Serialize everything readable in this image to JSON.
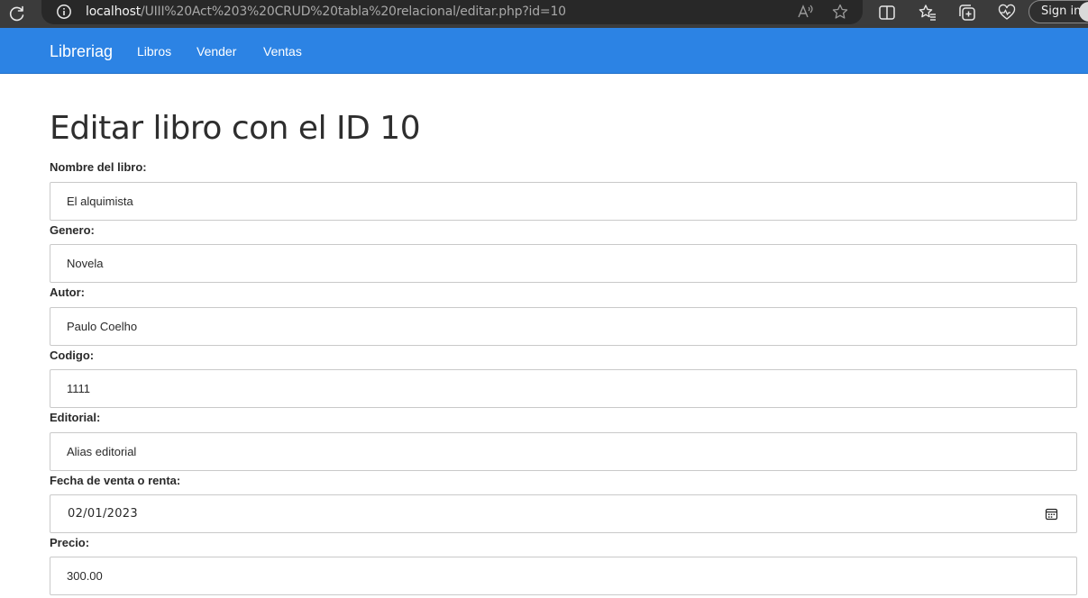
{
  "browser": {
    "url_host": "localhost",
    "url_path": "/UIII%20Act%203%20CRUD%20tabla%20relacional/editar.php?id=10",
    "signin_label": "Sign in"
  },
  "navbar": {
    "brand": "Libreriag",
    "links": [
      "Libros",
      "Vender",
      "Ventas"
    ]
  },
  "page": {
    "title": "Editar libro con el ID 10"
  },
  "form": {
    "fields": [
      {
        "label": "Nombre del libro:",
        "value": "El alquimista"
      },
      {
        "label": "Genero:",
        "value": "Novela"
      },
      {
        "label": "Autor:",
        "value": "Paulo Coelho"
      },
      {
        "label": "Codigo:",
        "value": "1111"
      },
      {
        "label": "Editorial:",
        "value": "Alias editorial"
      },
      {
        "label": "Fecha de venta o renta:",
        "value": "02/01/2023"
      },
      {
        "label": "Precio:",
        "value": "300.00"
      }
    ]
  },
  "icons": {
    "reload": "reload-icon",
    "site_info": "info-icon",
    "read_aloud": "read-aloud-icon",
    "favorite": "star-icon",
    "split_screen": "split-screen-icon",
    "favorites": "favorites-icon",
    "collections": "collections-icon",
    "health": "heart-pulse-icon",
    "calendar": "calendar-icon"
  },
  "colors": {
    "navbar": "#2c83e4",
    "browser_chrome": "#3b3b3b"
  }
}
